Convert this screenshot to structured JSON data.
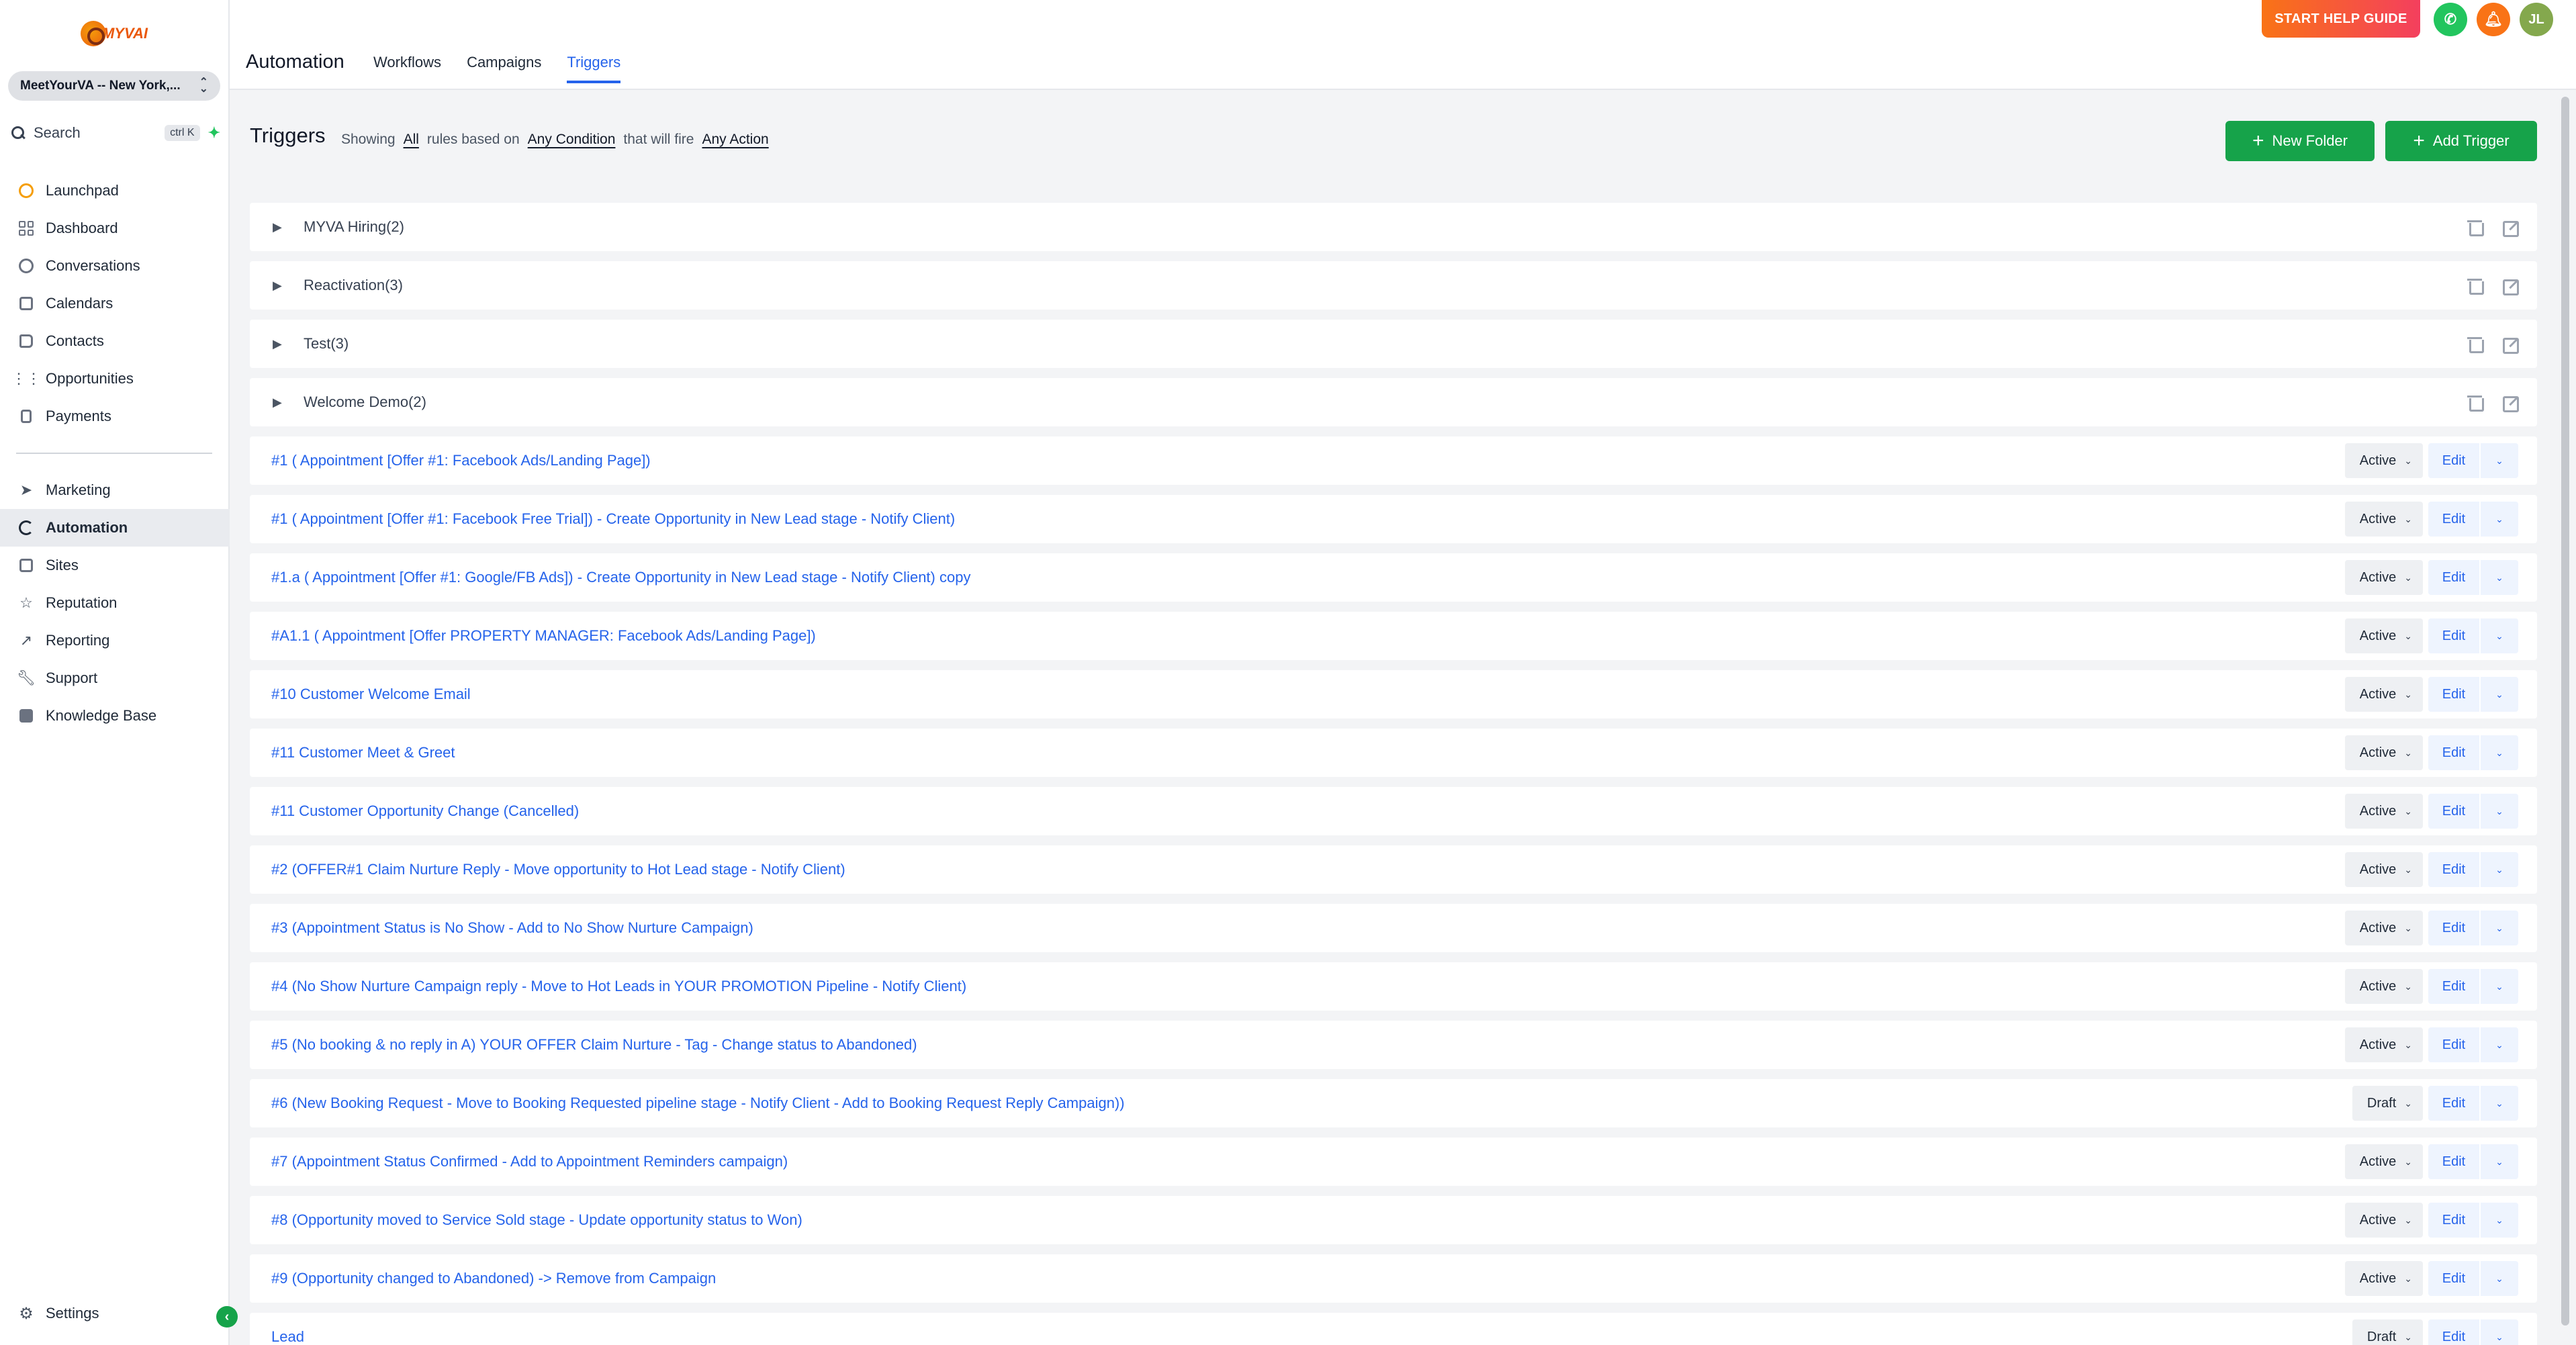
{
  "brand": {
    "logo_text": "MYVAI",
    "accent": "#16a34a",
    "link": "#2563eb"
  },
  "location": {
    "name": "MeetYourVA -- New York,..."
  },
  "search": {
    "label": "Search",
    "shortcut": "ctrl K"
  },
  "sidebar": {
    "items": [
      {
        "label": "Launchpad",
        "icon": "rocket-icon"
      },
      {
        "label": "Dashboard",
        "icon": "dashboard-icon"
      },
      {
        "label": "Conversations",
        "icon": "chat-icon"
      },
      {
        "label": "Calendars",
        "icon": "calendar-icon"
      },
      {
        "label": "Contacts",
        "icon": "contacts-icon"
      },
      {
        "label": "Opportunities",
        "icon": "opportunities-icon"
      },
      {
        "label": "Payments",
        "icon": "payments-icon"
      }
    ],
    "items2": [
      {
        "label": "Marketing",
        "icon": "send-icon"
      },
      {
        "label": "Automation",
        "icon": "automation-icon",
        "active": true
      },
      {
        "label": "Sites",
        "icon": "sites-icon"
      },
      {
        "label": "Reputation",
        "icon": "star-icon"
      },
      {
        "label": "Reporting",
        "icon": "chart-icon"
      },
      {
        "label": "Support",
        "icon": "wrench-icon"
      },
      {
        "label": "Knowledge Base",
        "icon": "book-icon"
      }
    ],
    "settings": "Settings"
  },
  "header": {
    "title": "Automation",
    "tabs": [
      "Workflows",
      "Campaigns",
      "Triggers"
    ],
    "active_tab": "Triggers",
    "help_button": "START HELP GUIDE",
    "avatar": "JL"
  },
  "page": {
    "title": "Triggers",
    "filter": {
      "showing": "Showing",
      "all": "All",
      "rules_based_on": "rules based on",
      "condition": "Any Condition",
      "that_will_fire": "that will fire",
      "action": "Any Action"
    },
    "new_folder": "New Folder",
    "add_trigger": "Add Trigger"
  },
  "folders": [
    {
      "name": "MYVA Hiring(2)"
    },
    {
      "name": "Reactivation(3)"
    },
    {
      "name": "Test(3)"
    },
    {
      "name": "Welcome Demo(2)"
    }
  ],
  "triggers": [
    {
      "name": "#1 ( Appointment [Offer #1: Facebook Ads/Landing Page])",
      "status": "Active"
    },
    {
      "name": "#1 ( Appointment [Offer #1: Facebook Free Trial]) - Create Opportunity in New Lead stage - Notify Client)",
      "status": "Active"
    },
    {
      "name": "#1.a ( Appointment [Offer #1: Google/FB Ads]) - Create Opportunity in New Lead stage - Notify Client) copy",
      "status": "Active"
    },
    {
      "name": "#A1.1 ( Appointment [Offer PROPERTY MANAGER: Facebook Ads/Landing Page])",
      "status": "Active"
    },
    {
      "name": "#10 Customer Welcome Email",
      "status": "Active"
    },
    {
      "name": "#11 Customer Meet & Greet",
      "status": "Active"
    },
    {
      "name": "#11 Customer Opportunity Change (Cancelled)",
      "status": "Active"
    },
    {
      "name": "#2 (OFFER#1 Claim Nurture Reply - Move opportunity to Hot Lead stage - Notify Client)",
      "status": "Active"
    },
    {
      "name": "#3 (Appointment Status is No Show - Add to No Show Nurture Campaign)",
      "status": "Active"
    },
    {
      "name": "#4 (No Show Nurture Campaign reply - Move to Hot Leads in YOUR PROMOTION Pipeline - Notify Client)",
      "status": "Active"
    },
    {
      "name": "#5 (No booking & no reply in A) YOUR OFFER Claim Nurture - Tag - Change status to Abandoned)",
      "status": "Active"
    },
    {
      "name": "#6 (New Booking Request - Move to Booking Requested pipeline stage - Notify Client - Add to Booking Request Reply Campaign))",
      "status": "Draft"
    },
    {
      "name": "#7 (Appointment Status Confirmed - Add to Appointment Reminders campaign)",
      "status": "Active"
    },
    {
      "name": "#8 (Opportunity moved to Service Sold stage - Update opportunity status to Won)",
      "status": "Active"
    },
    {
      "name": "#9 (Opportunity changed to Abandoned) -> Remove from Campaign",
      "status": "Active"
    },
    {
      "name": "Lead",
      "status": "Draft"
    }
  ],
  "row_edit_label": "Edit"
}
